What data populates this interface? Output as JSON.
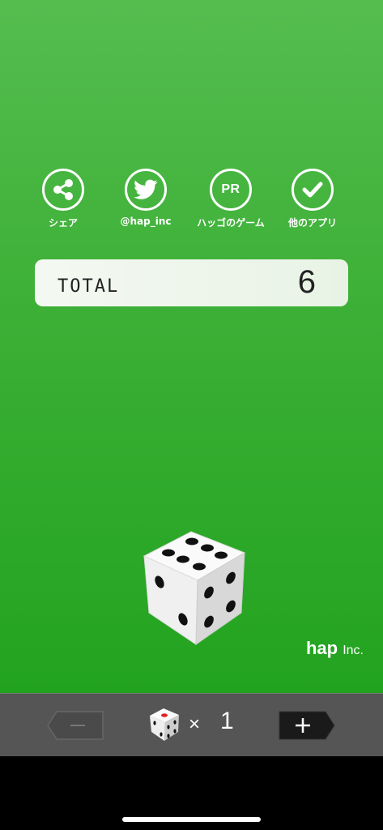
{
  "share": {
    "items": [
      {
        "label": "シェア",
        "icon": "share-icon"
      },
      {
        "label": "@hap_inc",
        "icon": "twitter-bird-icon"
      },
      {
        "label": "ハッゴのゲーム",
        "icon": "pr-icon",
        "icon_text": "PR"
      },
      {
        "label": "他のアプリ",
        "icon": "checkmark-icon"
      }
    ]
  },
  "total": {
    "label": "TOTAL",
    "value": "6"
  },
  "dice": {
    "top_face": 6,
    "icon": "dice-icon"
  },
  "brand": {
    "name": "hap",
    "suffix": "Inc."
  },
  "toolbar": {
    "minus_label": "−",
    "plus_label": "+",
    "times_label": "×",
    "dice_count": "1"
  },
  "colors": {
    "background_top": "#55bd4f",
    "background_bottom": "#22a31f",
    "toolbar": "#555555",
    "total_box": "#f1f7ef"
  }
}
